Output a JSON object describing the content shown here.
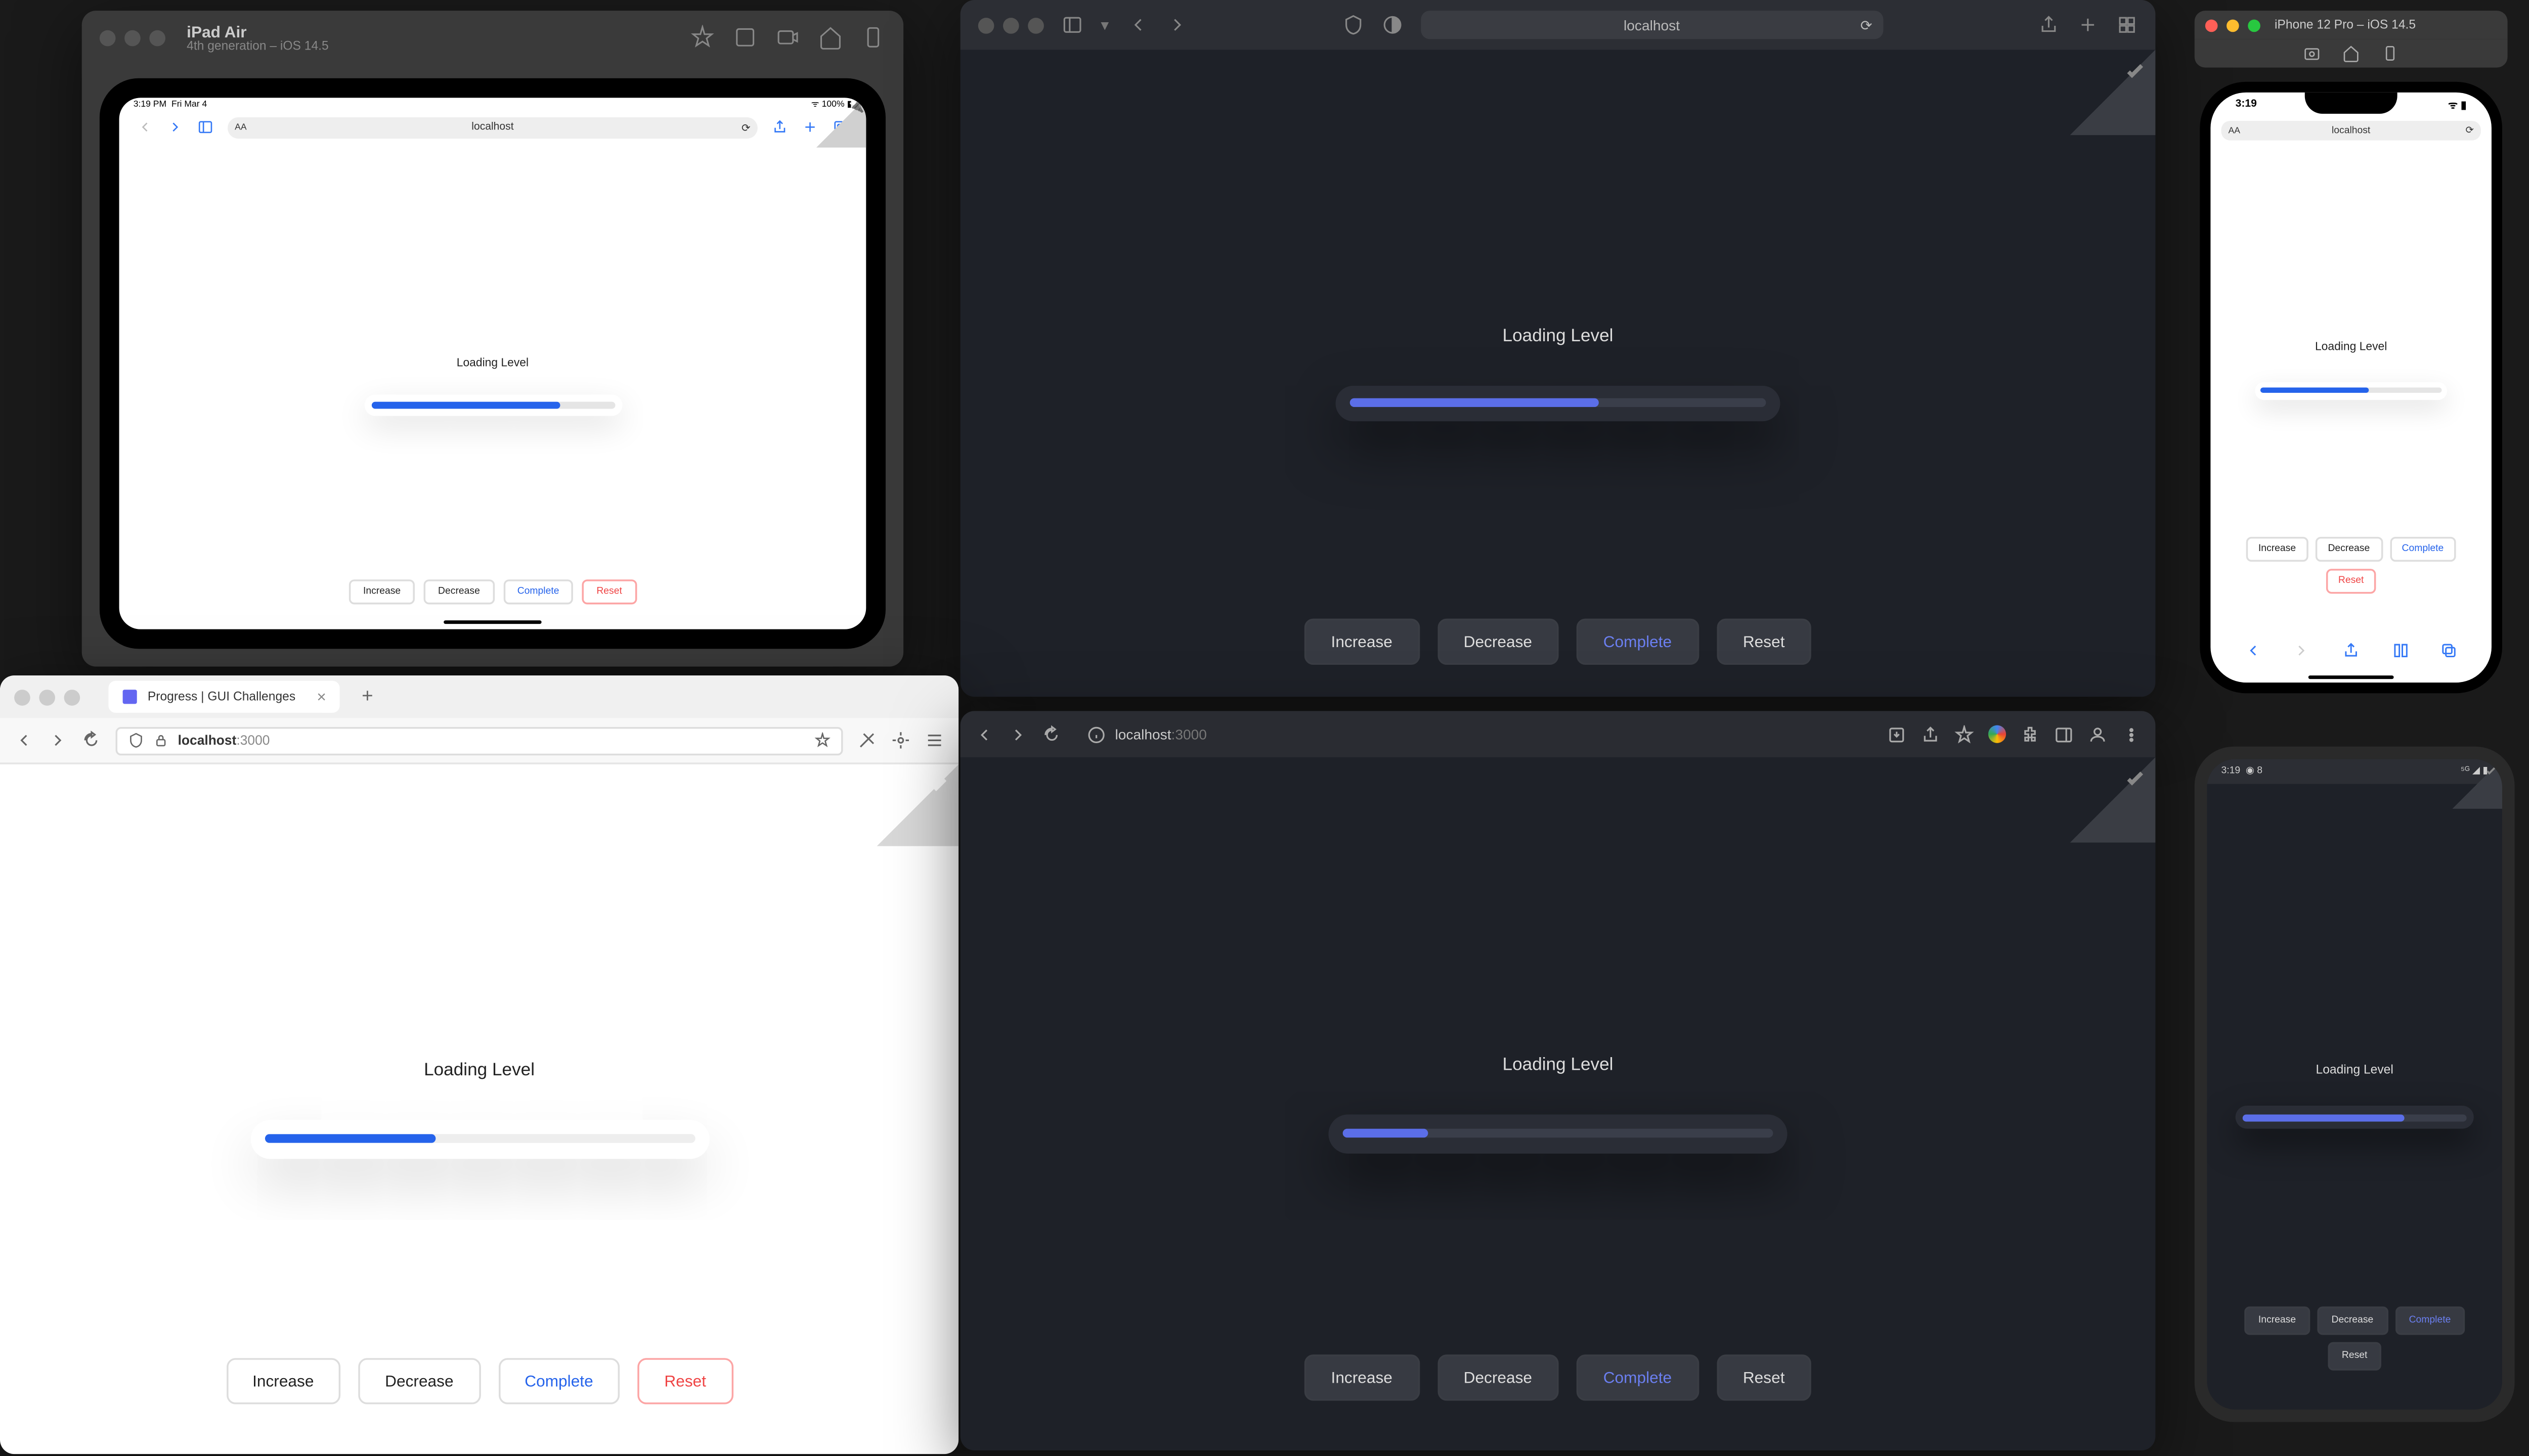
{
  "app": {
    "loading_label": "Loading Level",
    "buttons": {
      "increase": "Increase",
      "decrease": "Decrease",
      "complete": "Complete",
      "reset": "Reset"
    }
  },
  "ipad_sim": {
    "title": "iPad Air",
    "subtitle": "4th generation – iOS 14.5",
    "status_time": "3:19 PM",
    "status_date": "Fri Mar 4",
    "status_right": "100%",
    "url": "localhost",
    "url_aa": "AA",
    "progress_pct": 78
  },
  "safari": {
    "url": "localhost",
    "progress_pct": 60
  },
  "iphone_sim": {
    "title": "iPhone 12 Pro – iOS 14.5",
    "status_time": "3:19",
    "url": "localhost",
    "url_aa": "AA",
    "progress_pct": 60
  },
  "firefox": {
    "tab_title": "Progress | GUI Challenges",
    "url_host": "localhost",
    "url_port": ":3000",
    "progress_pct": 40
  },
  "chrome": {
    "url_host": "localhost",
    "url_port": ":3000",
    "progress_pct": 20
  },
  "android": {
    "status_time": "3:19",
    "status_icon": "8",
    "progress_pct": 72
  }
}
